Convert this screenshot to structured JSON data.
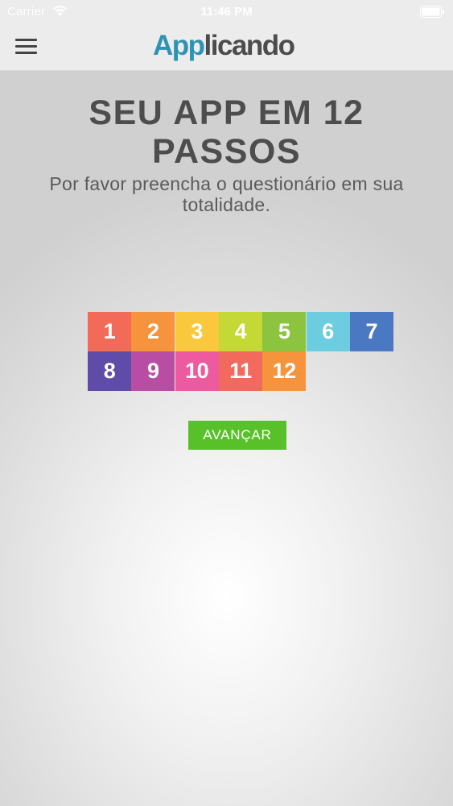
{
  "status_bar": {
    "carrier": "Carrier",
    "time": "11:46 PM"
  },
  "nav": {
    "logo_highlight": "App",
    "logo_rest": "licando"
  },
  "header": {
    "title_line1": "SEU APP EM 12",
    "title_line2": "PASSOS",
    "subtitle": "Por favor preencha o questionário em sua totalidade."
  },
  "steps": [
    {
      "label": "1",
      "color": "#f26b58"
    },
    {
      "label": "2",
      "color": "#f5943c"
    },
    {
      "label": "3",
      "color": "#f9c83c"
    },
    {
      "label": "4",
      "color": "#c4d936"
    },
    {
      "label": "5",
      "color": "#8cc43f"
    },
    {
      "label": "6",
      "color": "#6ccde0"
    },
    {
      "label": "7",
      "color": "#4a78c2"
    },
    {
      "label": "8",
      "color": "#5f4ba8"
    },
    {
      "label": "9",
      "color": "#b74ea4"
    },
    {
      "label": "10",
      "color": "#ee5aa0"
    },
    {
      "label": "11",
      "color": "#f2695e"
    },
    {
      "label": "12",
      "color": "#f5943c"
    }
  ],
  "actions": {
    "advance_label": "AVANÇAR",
    "advance_color": "#58c12a"
  },
  "icons": {
    "menu": "hamburger-menu-icon",
    "wifi": "wifi-icon",
    "battery": "battery-icon"
  }
}
